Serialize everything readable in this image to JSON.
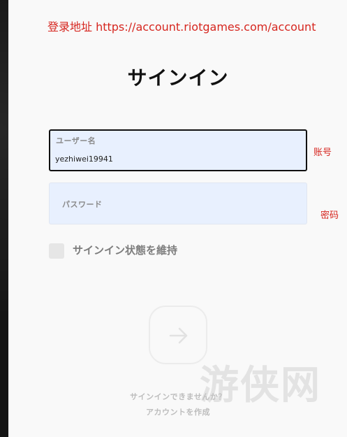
{
  "annotations": {
    "top": "登录地址 https://account.riotgames.com/account",
    "account": "账号",
    "password": "密码"
  },
  "title": "サインイン",
  "username": {
    "label": "ユーザー名",
    "value": "yezhiwei19941"
  },
  "password": {
    "label": "パスワード",
    "value": ""
  },
  "remember": {
    "label": "サインイン状態を維持",
    "checked": false
  },
  "submit": {
    "icon": "arrow-right-icon"
  },
  "links": {
    "cant_sign_in": "サインインできませんか？",
    "create_account": "アカウントを作成"
  },
  "watermark": "游侠网",
  "colors": {
    "annotation": "#d6261f",
    "field_bg": "#e8f0fe",
    "panel_bg": "#f9f9f9"
  }
}
